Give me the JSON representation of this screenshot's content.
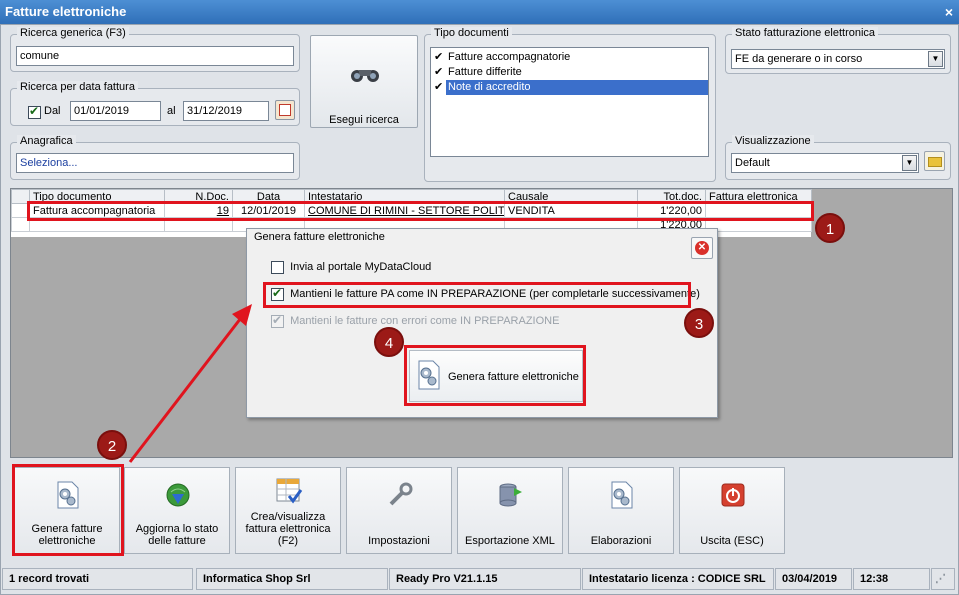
{
  "window": {
    "title": "Fatture elettroniche",
    "close_glyph": "×"
  },
  "search": {
    "generic_label": "Ricerca generica (F3)",
    "generic_value": "comune",
    "date_label": "Ricerca per data fattura",
    "date_from_label": "Dal",
    "date_from": "01/01/2019",
    "date_to_label": "al",
    "date_to": "31/12/2019",
    "anagrafica_label": "Anagrafica",
    "anagrafica_value": "Seleziona...",
    "search_button": "Esegui ricerca"
  },
  "doc_types": {
    "label": "Tipo documenti",
    "items": [
      {
        "label": "Fatture accompagnatorie",
        "checked": true
      },
      {
        "label": "Fatture differite",
        "checked": true
      },
      {
        "label": "Note di accredito",
        "checked": true
      }
    ]
  },
  "status_filter": {
    "label": "Stato fatturazione elettronica",
    "value": "FE da generare o in corso"
  },
  "view": {
    "label": "Visualizzazione",
    "value": "Default"
  },
  "grid": {
    "columns": [
      "Tipo documento",
      "N.Doc.",
      "Data",
      "Intestatario",
      "Causale",
      "Tot.doc.",
      "Fattura elettronica"
    ],
    "rows": [
      {
        "tipo": "Fattura accompagnatoria",
        "ndoc": "19",
        "data": "12/01/2019",
        "intestatario": "COMUNE DI RIMINI - SETTORE POLIT...",
        "causale": "VENDITA",
        "tot": "1'220,00",
        "fe": ""
      }
    ],
    "total": "1'220,00"
  },
  "dialog": {
    "title": "Genera fatture elettroniche",
    "opt1": "Invia al portale MyDataCloud",
    "opt2": "Mantieni le fatture PA come IN PREPARAZIONE (per completarle successivamente)",
    "opt3": "Mantieni le fatture con errori come IN PREPARAZIONE",
    "generate_button": "Genera fatture elettroniche"
  },
  "badges": [
    "1",
    "2",
    "3",
    "4"
  ],
  "toolbar": [
    {
      "label": "Genera fatture\nelettroniche",
      "icon": "document-gear-icon"
    },
    {
      "label": "Aggiorna lo stato\ndelle fatture",
      "icon": "globe-download-icon"
    },
    {
      "label": "Crea/visualizza\nfattura elettronica\n(F2)",
      "icon": "spreadsheet-check-icon"
    },
    {
      "label": "Impostazioni",
      "icon": "wrench-icon"
    },
    {
      "label": "Esportazione XML",
      "icon": "database-export-icon"
    },
    {
      "label": "Elaborazioni",
      "icon": "document-gear-icon"
    },
    {
      "label": "Uscita (ESC)",
      "icon": "power-icon"
    }
  ],
  "statusbar": {
    "records": "1 record trovati",
    "company": "Informatica Shop Srl",
    "version": "Ready Pro V21.1.15",
    "license": "Intestatario licenza : CODICE SRL",
    "date": "03/04/2019",
    "time": "12:38"
  },
  "colors": {
    "title_bar": "#3a7bc8",
    "highlight": "#e0141e",
    "badge": "#9c1a17",
    "selection": "#3b6fcb"
  }
}
